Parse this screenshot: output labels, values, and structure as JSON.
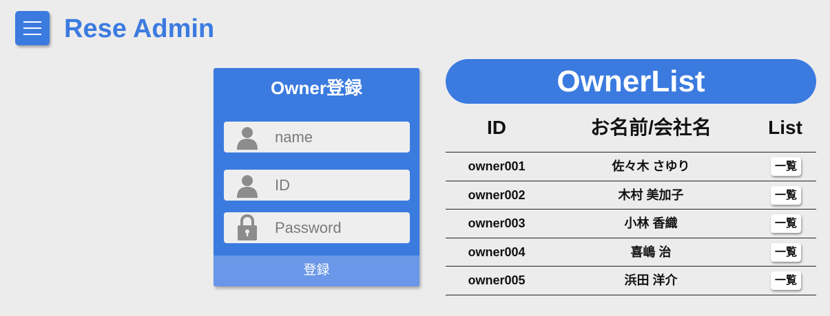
{
  "header": {
    "title": "Rese Admin",
    "menu_icon": "hamburger-menu-icon"
  },
  "registration": {
    "title": "Owner登録",
    "name_placeholder": "name",
    "id_placeholder": "ID",
    "password_placeholder": "Password",
    "submit_label": "登録",
    "icons": {
      "name": "user-icon",
      "id": "user-icon",
      "password": "padlock-icon"
    }
  },
  "owner_list": {
    "title": "OwnerList",
    "columns": [
      "ID",
      "お名前/会社名",
      "List"
    ],
    "rows": [
      {
        "id": "owner001",
        "name": "佐々木 さゆり",
        "action": "一覧"
      },
      {
        "id": "owner002",
        "name": "木村 美加子",
        "action": "一覧"
      },
      {
        "id": "owner003",
        "name": "小林 香織",
        "action": "一覧"
      },
      {
        "id": "owner004",
        "name": "喜嶋 治",
        "action": "一覧"
      },
      {
        "id": "owner005",
        "name": "浜田 洋介",
        "action": "一覧"
      }
    ]
  },
  "colors": {
    "accent": "#3b7be0",
    "accent_light": "#6a97e8",
    "background": "#ececec",
    "field_background": "#eeeeee",
    "icon_gray": "#8c8c8c"
  }
}
